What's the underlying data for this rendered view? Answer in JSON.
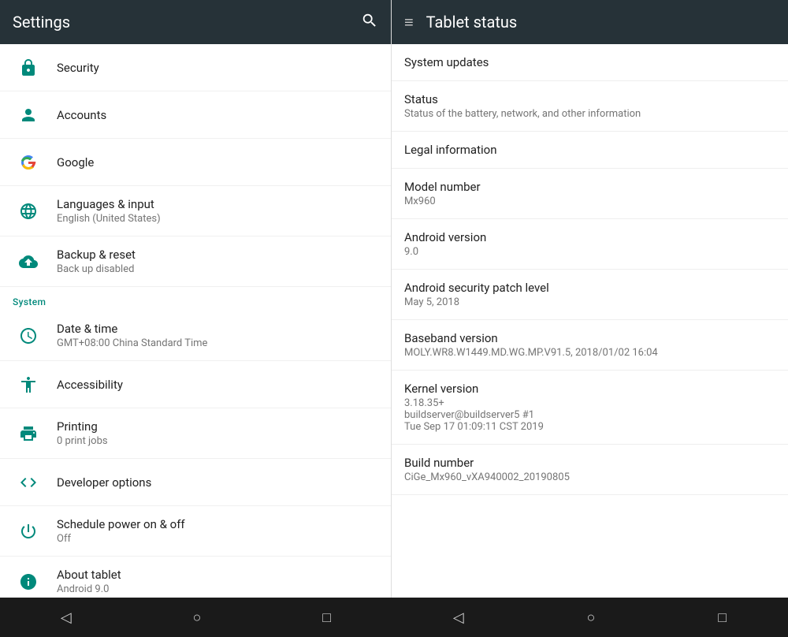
{
  "left": {
    "header": {
      "title": "Settings",
      "search_icon": "search"
    },
    "items": [
      {
        "id": "security",
        "label": "Security",
        "sublabel": "",
        "icon": "lock"
      },
      {
        "id": "accounts",
        "label": "Accounts",
        "sublabel": "",
        "icon": "person"
      },
      {
        "id": "google",
        "label": "Google",
        "sublabel": "",
        "icon": "google"
      },
      {
        "id": "languages",
        "label": "Languages & input",
        "sublabel": "English (United States)",
        "icon": "language"
      },
      {
        "id": "backup",
        "label": "Backup & reset",
        "sublabel": "Back up disabled",
        "icon": "backup"
      }
    ],
    "system_header": "System",
    "system_items": [
      {
        "id": "datetime",
        "label": "Date & time",
        "sublabel": "GMT+08:00 China Standard Time",
        "icon": "clock"
      },
      {
        "id": "accessibility",
        "label": "Accessibility",
        "sublabel": "",
        "icon": "accessibility"
      },
      {
        "id": "printing",
        "label": "Printing",
        "sublabel": "0 print jobs",
        "icon": "print"
      },
      {
        "id": "developer",
        "label": "Developer options",
        "sublabel": "",
        "icon": "code"
      },
      {
        "id": "schedule",
        "label": "Schedule power on & off",
        "sublabel": "Off",
        "icon": "power"
      },
      {
        "id": "about",
        "label": "About tablet",
        "sublabel": "Android 9.0",
        "icon": "info"
      }
    ]
  },
  "right": {
    "header": {
      "menu_icon": "menu",
      "title": "Tablet status"
    },
    "items": [
      {
        "id": "system-updates",
        "label": "System updates",
        "value": ""
      },
      {
        "id": "status",
        "label": "Status",
        "value": "Status of the battery, network, and other information"
      },
      {
        "id": "legal",
        "label": "Legal information",
        "value": ""
      },
      {
        "id": "model",
        "label": "Model number",
        "value": "Mx960"
      },
      {
        "id": "android-version",
        "label": "Android version",
        "value": "9.0"
      },
      {
        "id": "security-patch",
        "label": "Android security patch level",
        "value": "May 5, 2018"
      },
      {
        "id": "baseband",
        "label": "Baseband version",
        "value": "MOLY.WR8.W1449.MD.WG.MP.V91.5, 2018/01/02 16:04"
      },
      {
        "id": "kernel",
        "label": "Kernel version",
        "value": "3.18.35+\nbuildserver@buildserver5 #1\nTue Sep 17 01:09:11 CST 2019"
      },
      {
        "id": "build",
        "label": "Build number",
        "value": "CiGe_Mx960_vXA940002_20190805"
      }
    ]
  },
  "nav": {
    "back": "◁",
    "home": "○",
    "recent": "□"
  }
}
